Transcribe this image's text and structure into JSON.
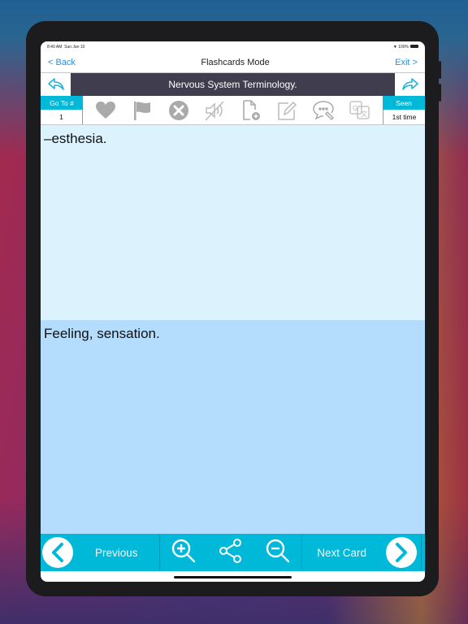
{
  "statusbar": {
    "time": "8:40 AM",
    "date": "Sun Jan 10",
    "battery": "100%"
  },
  "navbar": {
    "back_label": "< Back",
    "title": "Flashcards Mode",
    "exit_label": "Exit >"
  },
  "titlebar": {
    "deck_title": "Nervous System Terminology."
  },
  "toolbar": {
    "goto_label": "Go To #",
    "goto_value": "1",
    "seen_label": "Seen",
    "seen_value": "1st time",
    "icons": [
      "heart-icon",
      "flag-icon",
      "close-circle-icon",
      "audio-muted-icon",
      "add-document-icon",
      "edit-icon",
      "comment-edit-icon",
      "translate-icon"
    ]
  },
  "card": {
    "front_text": "–esthesia.",
    "back_text": "Feeling, sensation."
  },
  "bottombar": {
    "previous_label": "Previous",
    "next_label": "Next Card"
  },
  "colors": {
    "accent": "#00b8d8",
    "title_bg": "#3f3d4e",
    "front_bg": "#dcf3fe",
    "back_bg": "#b3dcfd",
    "link": "#2a8ee0"
  }
}
